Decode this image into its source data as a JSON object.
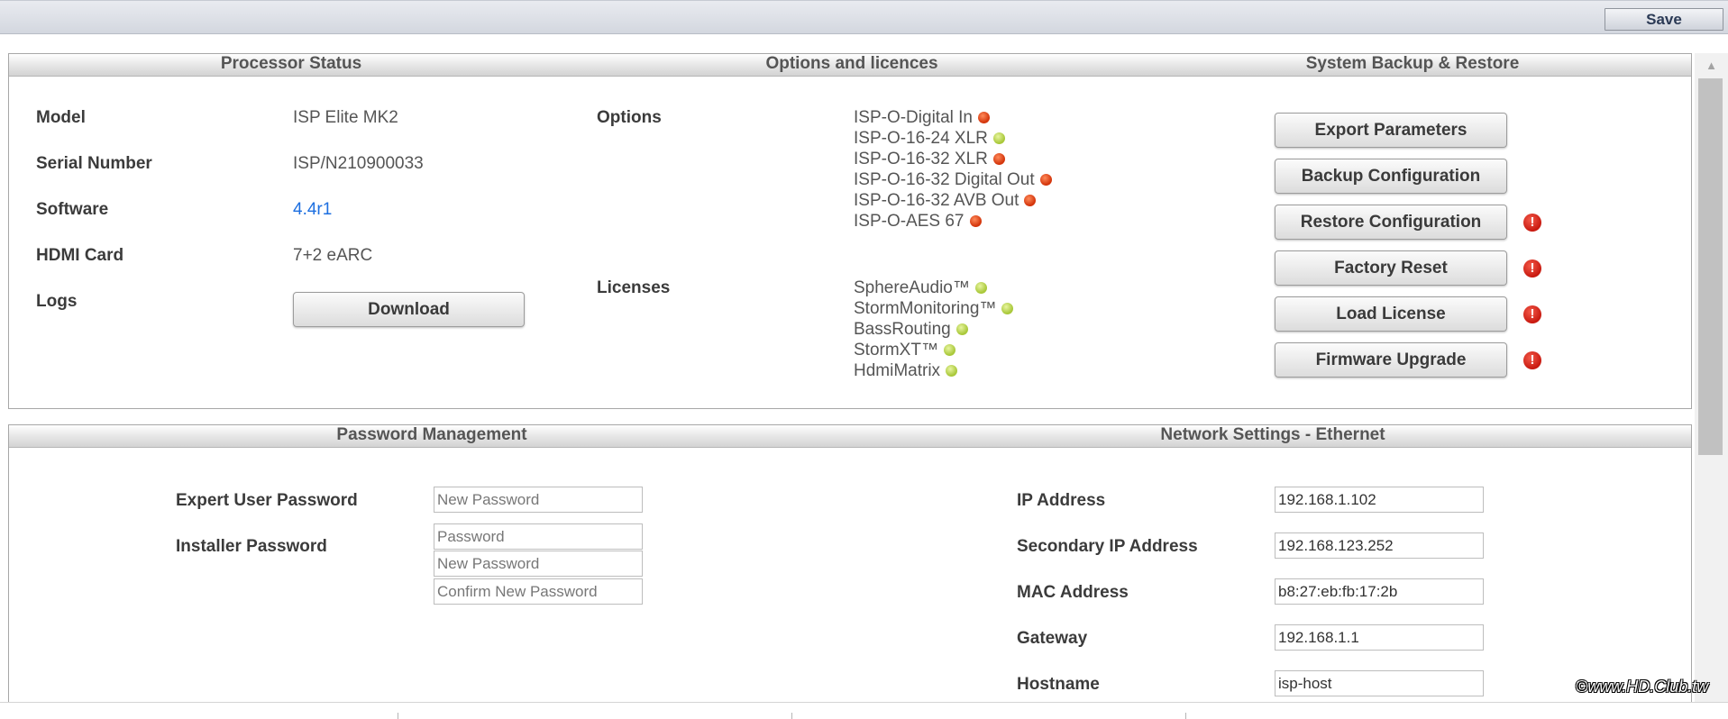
{
  "toolbar": {
    "save_label": "Save"
  },
  "processor_status": {
    "title": "Processor Status",
    "model_label": "Model",
    "model_value": "ISP Elite MK2",
    "serial_label": "Serial Number",
    "serial_value": "ISP/N210900033",
    "software_label": "Software",
    "software_value": "4.4r1",
    "hdmi_label": "HDMI Card",
    "hdmi_value": "7+2 eARC",
    "logs_label": "Logs",
    "download_label": "Download"
  },
  "options_licences": {
    "title": "Options and licences",
    "options_label": "Options",
    "options": [
      {
        "name": "ISP-O-Digital In",
        "status": "red"
      },
      {
        "name": "ISP-O-16-24 XLR",
        "status": "green"
      },
      {
        "name": "ISP-O-16-32 XLR",
        "status": "red"
      },
      {
        "name": "ISP-O-16-32 Digital Out",
        "status": "red"
      },
      {
        "name": "ISP-O-16-32 AVB Out",
        "status": "red"
      },
      {
        "name": "ISP-O-AES 67",
        "status": "red"
      }
    ],
    "licenses_label": "Licenses",
    "licenses": [
      {
        "name": "SphereAudio™",
        "status": "green"
      },
      {
        "name": "StormMonitoring™",
        "status": "green"
      },
      {
        "name": "BassRouting",
        "status": "green"
      },
      {
        "name": "StormXT™",
        "status": "green"
      },
      {
        "name": "HdmiMatrix",
        "status": "green"
      }
    ]
  },
  "backup_restore": {
    "title": "System Backup & Restore",
    "export_label": "Export Parameters",
    "backup_label": "Backup Configuration",
    "restore_label": "Restore Configuration",
    "factory_label": "Factory Reset",
    "load_license_label": "Load License",
    "firmware_label": "Firmware Upgrade",
    "warning_glyph": "!"
  },
  "password_management": {
    "title": "Password Management",
    "expert_label": "Expert User Password",
    "expert_new_placeholder": "New Password",
    "installer_label": "Installer Password",
    "installer_password_placeholder": "Password",
    "installer_new_placeholder": "New Password",
    "installer_confirm_placeholder": "Confirm New Password"
  },
  "network": {
    "title": "Network Settings - Ethernet",
    "ip_label": "IP Address",
    "ip_value": "192.168.1.102",
    "secondary_label": "Secondary IP Address",
    "secondary_value": "192.168.123.252",
    "mac_label": "MAC Address",
    "mac_value": "b8:27:eb:fb:17:2b",
    "gateway_label": "Gateway",
    "gateway_value": "192.168.1.1",
    "hostname_label": "Hostname",
    "hostname_value": "isp-host"
  },
  "watermark": "©www.HD.Club.tw",
  "colors": {
    "status_red": "#d4360c",
    "status_green": "#a9c83a",
    "link": "#1d6fe0",
    "warning": "#c8190f"
  }
}
